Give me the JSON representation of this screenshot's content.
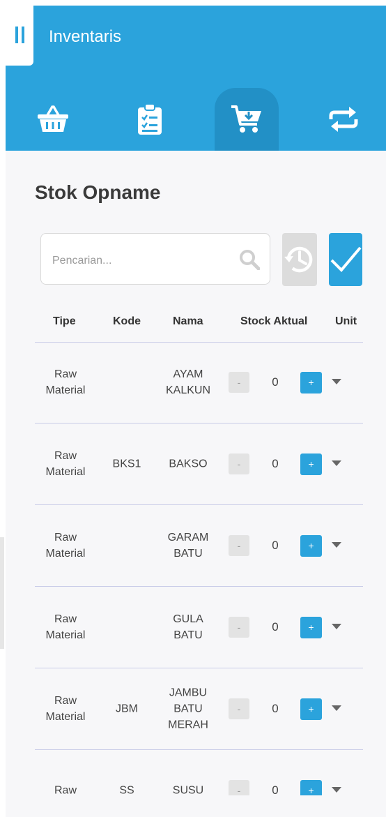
{
  "app": {
    "title": "Inventaris"
  },
  "nav": {
    "tabs": [
      {
        "icon": "basket-icon",
        "active": false
      },
      {
        "icon": "clipboard-checklist-icon",
        "active": false
      },
      {
        "icon": "cart-download-icon",
        "active": true
      },
      {
        "icon": "sync-arrows-icon",
        "active": false
      }
    ]
  },
  "page": {
    "title": "Stok Opname"
  },
  "search": {
    "placeholder": "Pencarian...",
    "value": ""
  },
  "actions": {
    "history_icon": "history-icon",
    "confirm_icon": "check-icon"
  },
  "table": {
    "headers": {
      "tipe": "Tipe",
      "kode": "Kode",
      "nama": "Nama",
      "stock": "Stock Aktual",
      "unit": "Unit"
    },
    "minus_label": "-",
    "plus_label": "+",
    "rows": [
      {
        "tipe": "Raw Material",
        "kode": "",
        "nama": "AYAM KALKUN",
        "qty": "0"
      },
      {
        "tipe": "Raw Material",
        "kode": "BKS1",
        "nama": "BAKSO",
        "qty": "0"
      },
      {
        "tipe": "Raw Material",
        "kode": "",
        "nama": "GARAM BATU",
        "qty": "0"
      },
      {
        "tipe": "Raw Material",
        "kode": "",
        "nama": "GULA BATU",
        "qty": "0"
      },
      {
        "tipe": "Raw Material",
        "kode": "JBM",
        "nama": "JAMBU BATU MERAH",
        "qty": "0"
      },
      {
        "tipe": "Raw",
        "kode": "SS",
        "nama": "SUSU",
        "qty": "0"
      }
    ]
  },
  "colors": {
    "primary": "#2ba3dc",
    "primary_dark": "#2290c6"
  }
}
